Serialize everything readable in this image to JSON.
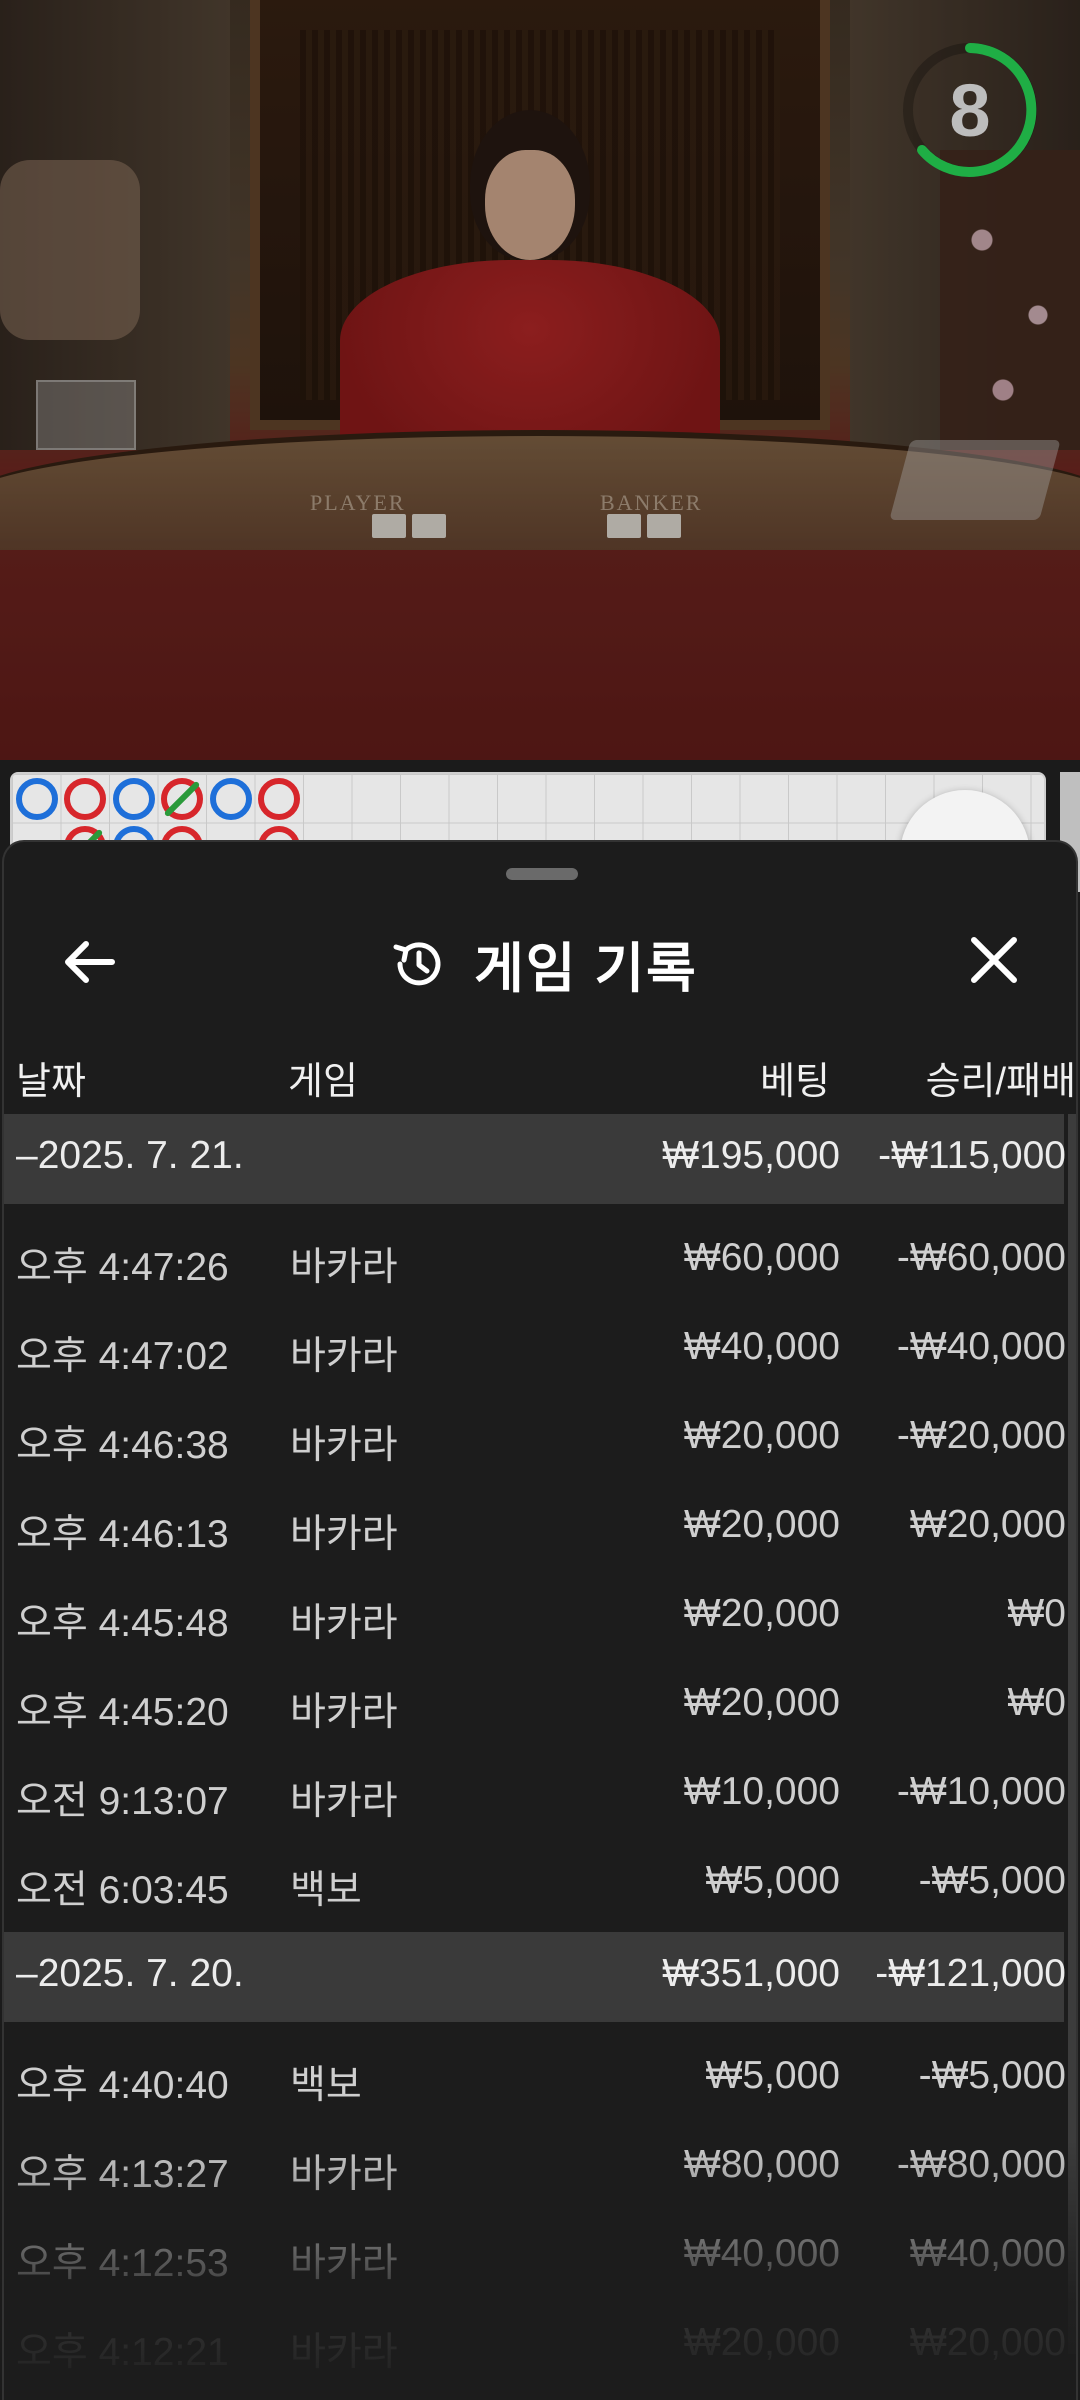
{
  "stream": {
    "timer_value": "8",
    "table_labels": {
      "player": "PLAYER",
      "banker": "BANKER"
    }
  },
  "bead_road": {
    "row1": [
      "blue",
      "red",
      "blue",
      "red",
      "blue",
      "red"
    ],
    "row2": [
      "red",
      "blue",
      "red",
      "red"
    ]
  },
  "history": {
    "title": "게임 기록",
    "columns": {
      "date": "날짜",
      "game": "게임",
      "bet": "베팅",
      "win_loss": "승리/패배"
    },
    "groups": [
      {
        "date": "–2025. 7. 21.",
        "total_bet": "₩195,000",
        "total_result": "-₩115,000",
        "rows": [
          {
            "time": "오후 4:47:26",
            "game": "바카라",
            "bet": "₩60,000",
            "result": "-₩60,000"
          },
          {
            "time": "오후 4:47:02",
            "game": "바카라",
            "bet": "₩40,000",
            "result": "-₩40,000"
          },
          {
            "time": "오후 4:46:38",
            "game": "바카라",
            "bet": "₩20,000",
            "result": "-₩20,000"
          },
          {
            "time": "오후 4:46:13",
            "game": "바카라",
            "bet": "₩20,000",
            "result": "₩20,000"
          },
          {
            "time": "오후 4:45:48",
            "game": "바카라",
            "bet": "₩20,000",
            "result": "₩0"
          },
          {
            "time": "오후 4:45:20",
            "game": "바카라",
            "bet": "₩20,000",
            "result": "₩0"
          },
          {
            "time": "오전 9:13:07",
            "game": "바카라",
            "bet": "₩10,000",
            "result": "-₩10,000"
          },
          {
            "time": "오전 6:03:45",
            "game": "백보",
            "bet": "₩5,000",
            "result": "-₩5,000"
          }
        ]
      },
      {
        "date": "–2025. 7. 20.",
        "total_bet": "₩351,000",
        "total_result": "-₩121,000",
        "rows": [
          {
            "time": "오후 4:40:40",
            "game": "백보",
            "bet": "₩5,000",
            "result": "-₩5,000"
          },
          {
            "time": "오후 4:13:27",
            "game": "바카라",
            "bet": "₩80,000",
            "result": "-₩80,000"
          },
          {
            "time": "오후 4:12:53",
            "game": "바카라",
            "bet": "₩40,000",
            "result": "₩40,000"
          },
          {
            "time": "오후 4:12:21",
            "game": "바카라",
            "bet": "₩20,000",
            "result": "₩20,000"
          }
        ]
      }
    ]
  }
}
